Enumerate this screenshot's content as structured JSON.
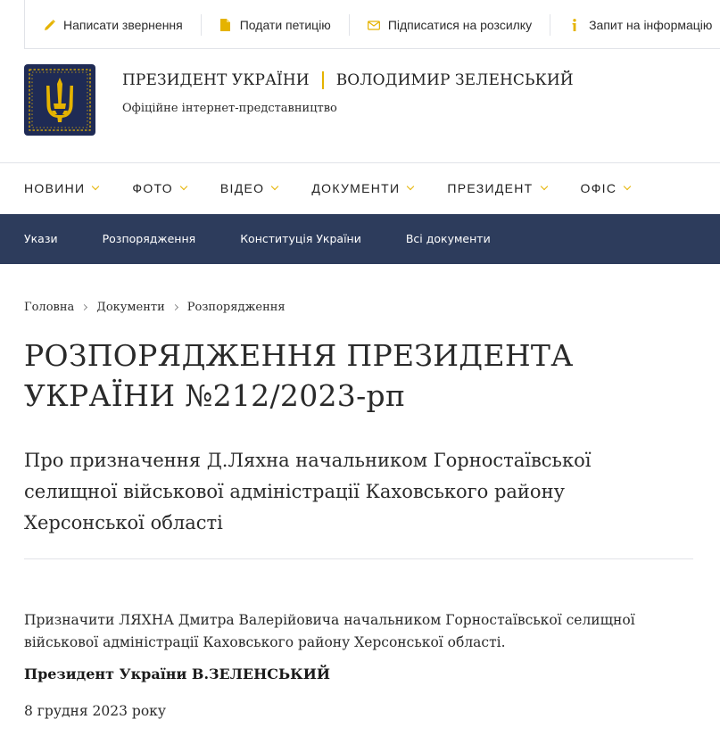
{
  "topbar": {
    "items": [
      {
        "label": "Написати звернення",
        "icon": "pencil-icon"
      },
      {
        "label": "Подати петицію",
        "icon": "document-icon"
      },
      {
        "label": "Підписатися на розсилку",
        "icon": "envelope-icon"
      },
      {
        "label": "Запит на інформацію",
        "icon": "info-icon"
      }
    ]
  },
  "header": {
    "title_left": "ПРЕЗИДЕНТ УКРАЇНИ",
    "title_right": "ВОЛОДИМИР ЗЕЛЕНСЬКИЙ",
    "subtitle": "Офіційне інтернет-представництво",
    "emblem_icon": "trident-emblem-icon"
  },
  "main_nav": {
    "items": [
      {
        "label": "НОВИНИ"
      },
      {
        "label": "ФОТО"
      },
      {
        "label": "ВІДЕО"
      },
      {
        "label": "ДОКУМЕНТИ"
      },
      {
        "label": "ПРЕЗИДЕНТ"
      },
      {
        "label": "ОФІС"
      }
    ]
  },
  "sub_nav": {
    "items": [
      {
        "label": "Укази"
      },
      {
        "label": "Розпорядження"
      },
      {
        "label": "Конституція України"
      },
      {
        "label": "Всі документи"
      }
    ]
  },
  "breadcrumb": {
    "items": [
      "Головна",
      "Документи",
      "Розпорядження"
    ]
  },
  "document": {
    "title_line1": "РОЗПОРЯДЖЕННЯ ПРЕЗИДЕНТА",
    "title_line2": "УКРАЇНИ №212/2023-рп",
    "subject": "Про призначення Д.Ляхна начальником Горностаївської селищної військової адміністрації Каховського району Херсонської області",
    "body": "Призначити ЛЯХНА Дмитра Валерійовича начальником Горностаївської селищної військової адміністрації Каховського району Херсонської області.",
    "signature": "Президент України В.ЗЕЛЕНСЬКИЙ",
    "date": "8 грудня 2023 року"
  },
  "colors": {
    "accent_gold": "#e5b300",
    "navy": "#1f2b55",
    "subnav_bg": "#2d3c5c",
    "divider": "#e1e3e8"
  }
}
